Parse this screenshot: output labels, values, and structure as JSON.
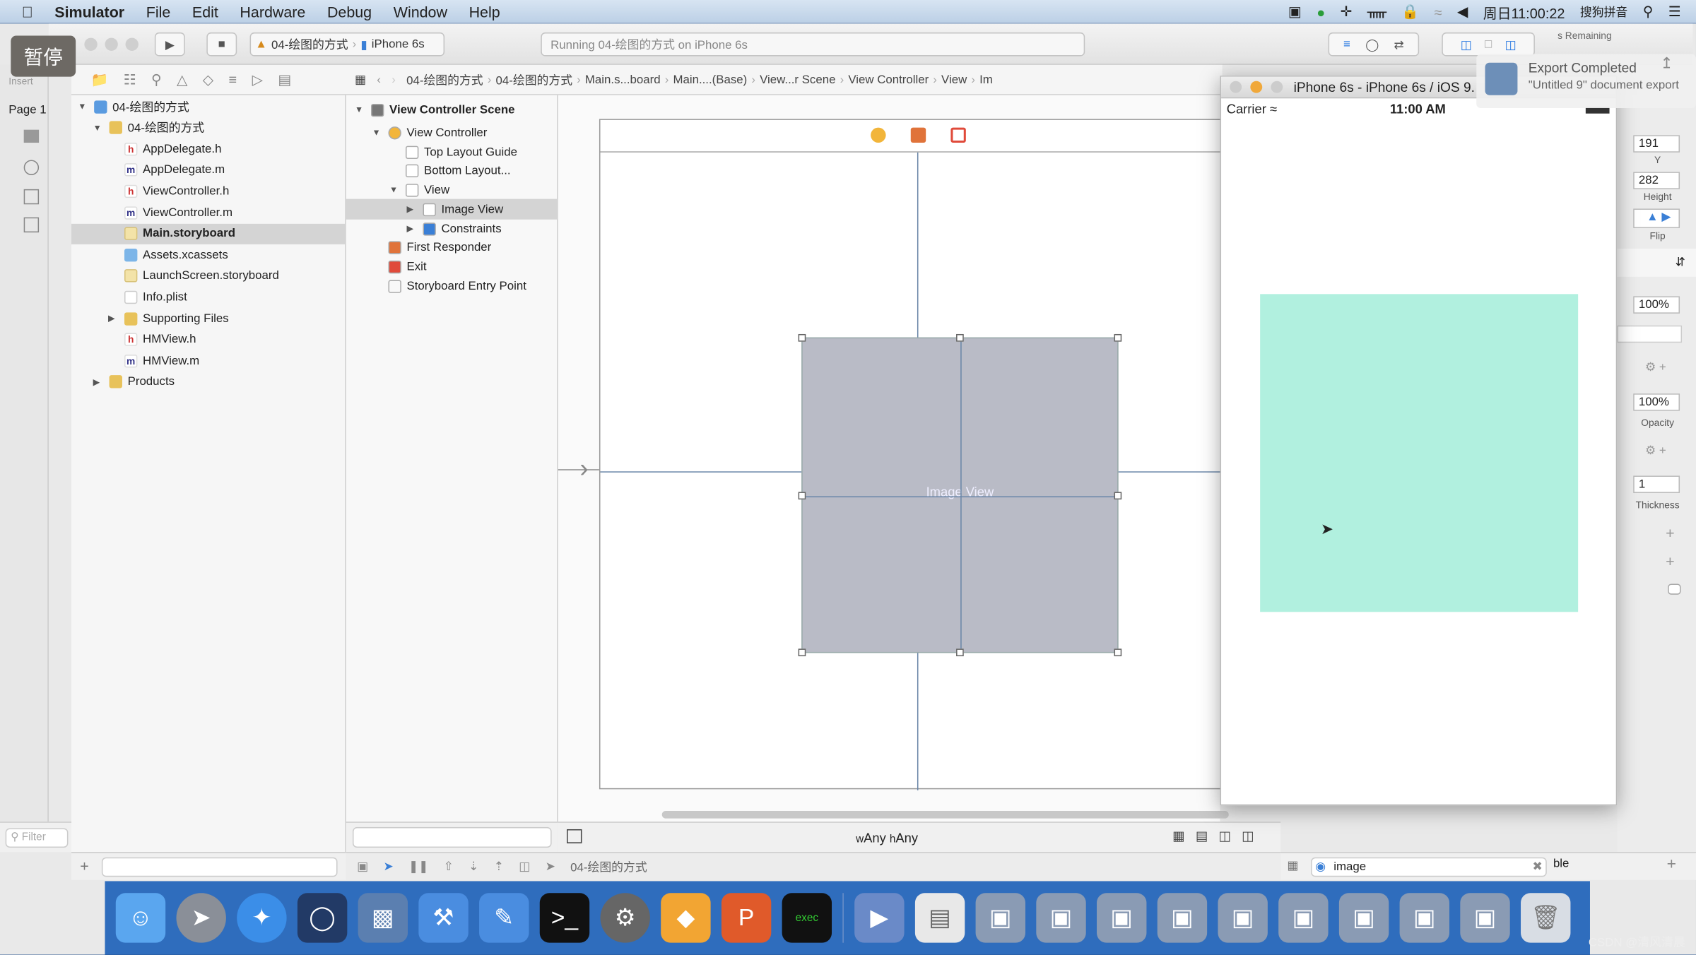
{
  "menubar": {
    "app": "Simulator",
    "items": [
      "File",
      "Edit",
      "Hardware",
      "Debug",
      "Window",
      "Help"
    ],
    "clock": "周日11:00:22",
    "ime": "搜狗拼音"
  },
  "overlay": {
    "pause": "暂停"
  },
  "toolbar": {
    "scheme": "04-绘图的方式",
    "device": "iPhone 6s",
    "activity": "Running 04-绘图的方式 on iPhone 6s",
    "remaining": "s Remaining"
  },
  "left_strip": {
    "insert": "Insert",
    "page": "Page 1"
  },
  "breadcrumb": [
    "04-绘图的方式",
    "04-绘图的方式",
    "Main.s...board",
    "Main....(Base)",
    "View...r Scene",
    "View Controller",
    "View",
    "Im"
  ],
  "file_navigator": {
    "items": [
      {
        "label": "04-绘图的方式",
        "type": "proj",
        "level": 0,
        "open": true
      },
      {
        "label": "04-绘图的方式",
        "type": "folder",
        "level": 1,
        "open": true
      },
      {
        "label": "AppDelegate.h",
        "type": "h",
        "level": 2
      },
      {
        "label": "AppDelegate.m",
        "type": "m",
        "level": 2
      },
      {
        "label": "ViewController.h",
        "type": "h",
        "level": 2
      },
      {
        "label": "ViewController.m",
        "type": "m",
        "level": 2
      },
      {
        "label": "Main.storyboard",
        "type": "sb",
        "level": 2,
        "selected": true
      },
      {
        "label": "Assets.xcassets",
        "type": "as",
        "level": 2
      },
      {
        "label": "LaunchScreen.storyboard",
        "type": "sb",
        "level": 2
      },
      {
        "label": "Info.plist",
        "type": "pl",
        "level": 2
      },
      {
        "label": "Supporting Files",
        "type": "folder",
        "level": 2,
        "closed": true
      },
      {
        "label": "HMView.h",
        "type": "h",
        "level": 2
      },
      {
        "label": "HMView.m",
        "type": "m",
        "level": 2
      },
      {
        "label": "Products",
        "type": "folder",
        "level": 1,
        "closed": true
      }
    ],
    "filter_placeholder": "Filter"
  },
  "outline": {
    "items": [
      {
        "label": "View Controller Scene",
        "level": 0,
        "bold": true
      },
      {
        "label": "View Controller",
        "level": 1
      },
      {
        "label": "Top Layout Guide",
        "level": 2
      },
      {
        "label": "Bottom Layout...",
        "level": 2
      },
      {
        "label": "View",
        "level": 2
      },
      {
        "label": "Image View",
        "level": 3,
        "selected": true
      },
      {
        "label": "Constraints",
        "level": 3
      },
      {
        "label": "First Responder",
        "level": 1
      },
      {
        "label": "Exit",
        "level": 1
      },
      {
        "label": "Storyboard Entry Point",
        "level": 1
      }
    ]
  },
  "canvas": {
    "image_view_label": "Image View",
    "size_class": {
      "w": "w",
      "w_val": "Any",
      "h": "h",
      "h_val": "Any"
    }
  },
  "simulator": {
    "title": "iPhone 6s - iPhone 6s / iOS 9.",
    "carrier": "Carrier",
    "time": "11:00 AM",
    "content_color": "#b1f0df"
  },
  "notification": {
    "title": "Export Completed",
    "body": "\"Untitled 9\" document export"
  },
  "inspector": {
    "x_value": "191",
    "y_label": "Y",
    "height_value": "282",
    "height_label": "Height",
    "flip_label": "Flip",
    "percent1": "100%",
    "opacity_value": "100%",
    "opacity_label": "Opacity",
    "thickness_value": "1",
    "thickness_label": "Thickness",
    "library_tail": "ble"
  },
  "debug": {
    "target": "04-绘图的方式"
  },
  "library_search": {
    "value": "image"
  },
  "watermark": "CSDN @清风清晨"
}
